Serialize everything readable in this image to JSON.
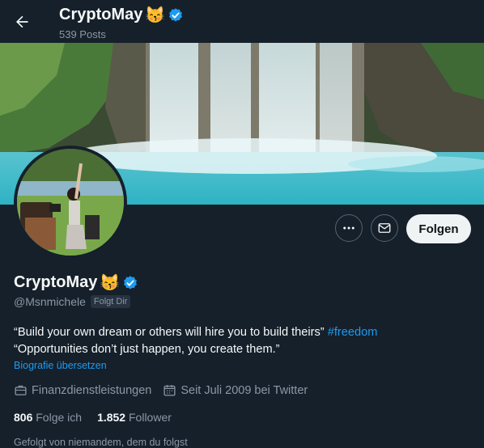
{
  "header": {
    "display_name": "CryptoMay",
    "emoji": "😽",
    "verified_icon": "verified-badge-icon",
    "posts_count": "539 Posts",
    "back_icon": "arrow-left-icon"
  },
  "actions": {
    "more_icon": "more-dots-icon",
    "message_icon": "envelope-icon",
    "follow_label": "Folgen"
  },
  "profile": {
    "display_name": "CryptoMay",
    "emoji": "😽",
    "handle": "@Msnmichele",
    "follows_you": "Folgt Dir",
    "bio_line1_text": "“Build your own dream or others will hire you to build theirs”",
    "bio_line1_hashtag": "#freedom",
    "bio_line2": "“Opportunities don’t just happen, you create them.”",
    "translate_label": "Biografie übersetzen",
    "category": "Finanzdienstleistungen",
    "category_icon": "briefcase-icon",
    "joined": "Seit Juli 2009 bei Twitter",
    "joined_icon": "calendar-icon",
    "following_count": "806",
    "following_label": "Folge ich",
    "followers_count": "1.852",
    "followers_label": "Follower",
    "known_followers": "Gefolgt von niemandem, dem du folgst"
  },
  "colors": {
    "background": "#15202b",
    "accent": "#1d9bf0",
    "secondary_text": "#8b98a5"
  }
}
